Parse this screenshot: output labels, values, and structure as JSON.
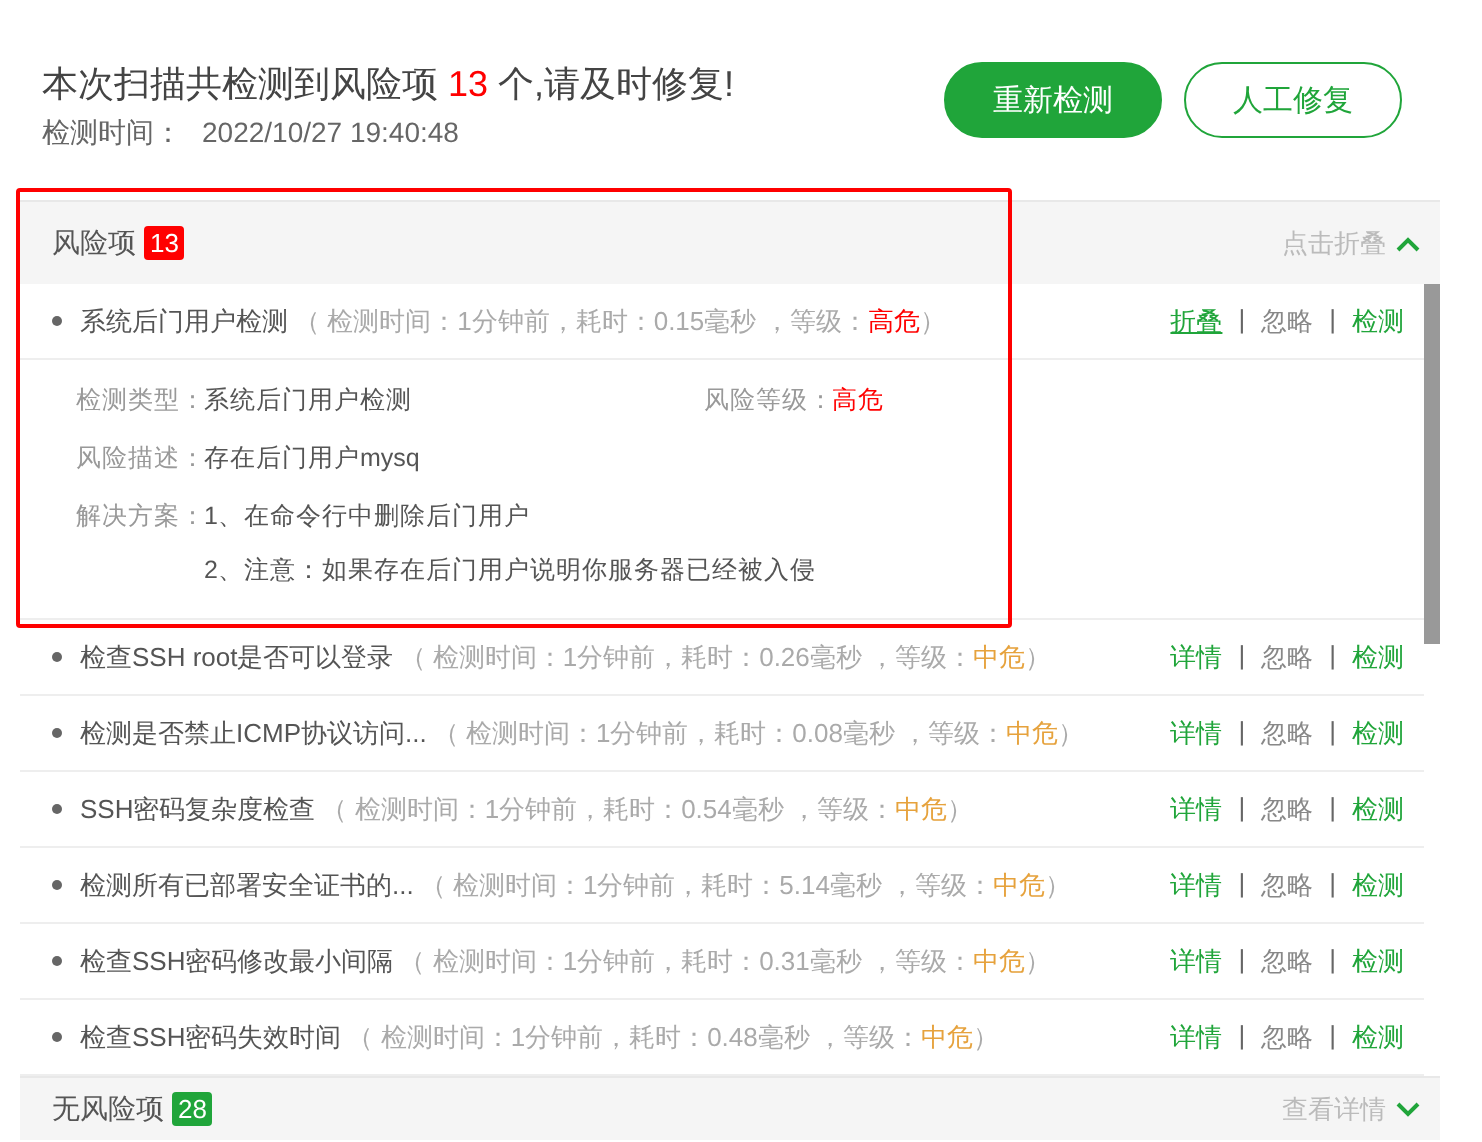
{
  "summary": {
    "before": "本次扫描共检测到风险项",
    "count": "13",
    "after": "个,请及时修复!"
  },
  "scan_time": {
    "label": "检测时间：",
    "value": "2022/10/27 19:40:48"
  },
  "buttons": [
    {
      "label": "重新检测",
      "kind": "primary"
    },
    {
      "label": "人工修复",
      "kind": "outline"
    }
  ],
  "separator": "|",
  "risk_section": {
    "title": "风险项",
    "count": "13",
    "toggle": "点击折叠",
    "expanded": true
  },
  "risk_items": [
    {
      "name": "系统后门用户检测",
      "meta": "（ 检测时间：1分钟前，耗时：0.15毫秒 ，等级：",
      "severity_label": "高危",
      "kind": "high",
      "close": "）",
      "expanded": true,
      "actions": [
        "折叠",
        "忽略",
        "检测"
      ],
      "detail": {
        "type_label": "检测类型：",
        "type_value": "系统后门用户检测",
        "level_label": "风险等级：",
        "level_value": "高危",
        "desc_label": "风险描述：",
        "desc_value": "存在后门用户mysq",
        "fix_label": "解决方案：",
        "fix_steps": [
          "1、在命令行中删除后门用户",
          "2、注意：如果存在后门用户说明你服务器已经被入侵"
        ]
      }
    },
    {
      "name": "检查SSH root是否可以登录",
      "meta": "（ 检测时间：1分钟前，耗时：0.26毫秒 ，等级：",
      "severity_label": "中危",
      "kind": "medium",
      "close": "）",
      "expanded": false,
      "actions": [
        "详情",
        "忽略",
        "检测"
      ]
    },
    {
      "name": "检测是否禁止ICMP协议访问...",
      "meta": "（ 检测时间：1分钟前，耗时：0.08毫秒 ，等级：",
      "severity_label": "中危",
      "kind": "medium",
      "close": "）",
      "expanded": false,
      "actions": [
        "详情",
        "忽略",
        "检测"
      ]
    },
    {
      "name": "SSH密码复杂度检查",
      "meta": "（ 检测时间：1分钟前，耗时：0.54毫秒 ，等级：",
      "severity_label": "中危",
      "kind": "medium",
      "close": "）",
      "expanded": false,
      "actions": [
        "详情",
        "忽略",
        "检测"
      ]
    },
    {
      "name": "检测所有已部署安全证书的...",
      "meta": "（ 检测时间：1分钟前，耗时：5.14毫秒 ，等级：",
      "severity_label": "中危",
      "kind": "medium",
      "close": "）",
      "expanded": false,
      "actions": [
        "详情",
        "忽略",
        "检测"
      ]
    },
    {
      "name": "检查SSH密码修改最小间隔",
      "meta": "（ 检测时间：1分钟前，耗时：0.31毫秒 ，等级：",
      "severity_label": "中危",
      "kind": "medium",
      "close": "）",
      "expanded": false,
      "actions": [
        "详情",
        "忽略",
        "检测"
      ]
    },
    {
      "name": "检查SSH密码失效时间",
      "meta": "（ 检测时间：1分钟前，耗时：0.48毫秒 ，等级：",
      "severity_label": "中危",
      "kind": "medium",
      "close": "）",
      "expanded": false,
      "actions": [
        "详情",
        "忽略",
        "检测"
      ]
    }
  ],
  "safe_section": {
    "title": "无风险项",
    "count": "28",
    "toggle": "查看详情",
    "expanded": false
  }
}
